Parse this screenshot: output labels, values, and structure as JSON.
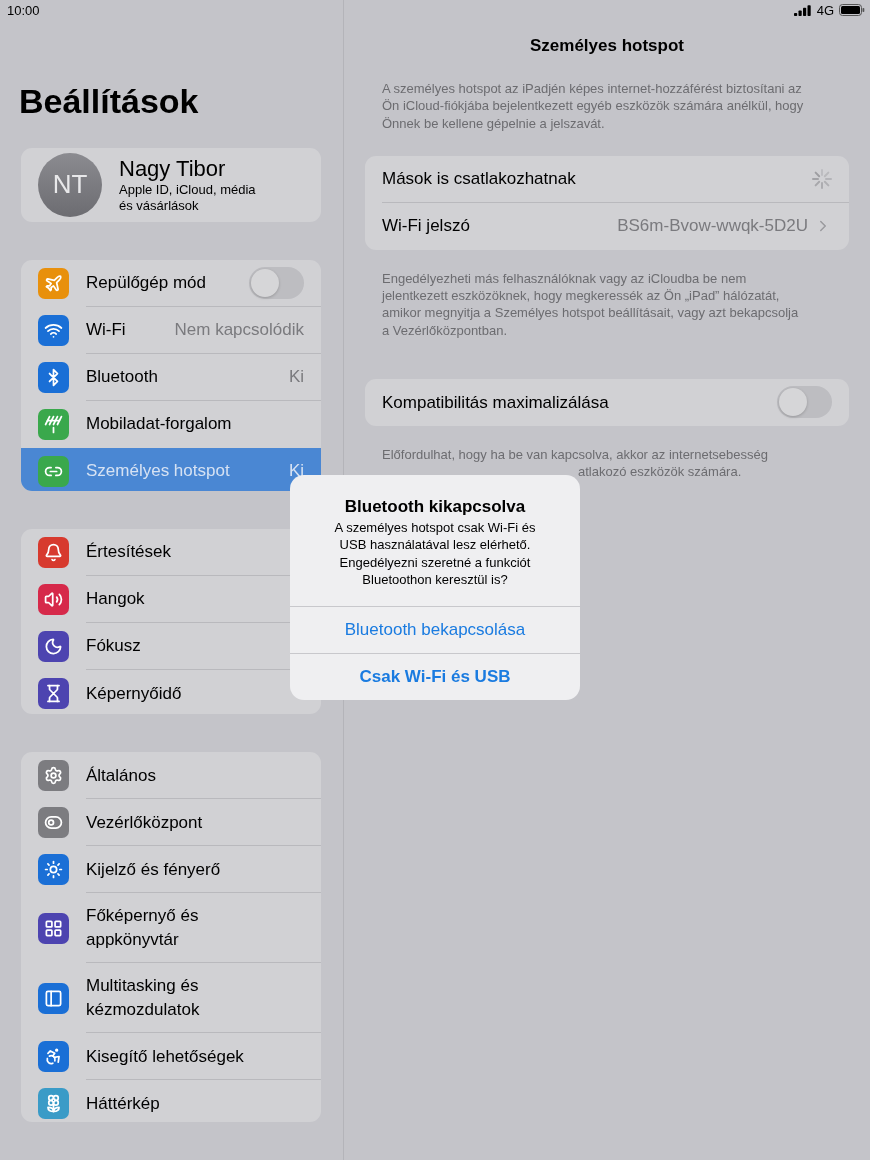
{
  "status_bar": {
    "time": "10:00",
    "network": "4G"
  },
  "sidebar": {
    "title": "Beállítások",
    "profile": {
      "initials": "NT",
      "name": "Nagy Tibor",
      "subtitle": "Apple ID, iCloud, média\nés vásárlások"
    },
    "groups": [
      {
        "items": [
          {
            "label": "Repülőgép mód",
            "kind": "toggle",
            "on": false,
            "color": "#e8900c",
            "selected": false
          },
          {
            "label": "Wi-Fi",
            "kind": "value",
            "value": "Nem kapcsolódik",
            "color": "#1a6fd6",
            "selected": false
          },
          {
            "label": "Bluetooth",
            "kind": "value",
            "value": "Ki",
            "color": "#1a6fd6",
            "selected": false
          },
          {
            "label": "Mobiladat-forgalom",
            "kind": "link",
            "color": "#3aa84c",
            "selected": false
          },
          {
            "label": "Személyes hotspot",
            "kind": "value",
            "value": "Ki",
            "color": "#3aa84c",
            "selected": true
          }
        ]
      },
      {
        "items": [
          {
            "label": "Értesítések",
            "kind": "link",
            "color": "#d73a2e",
            "selected": false
          },
          {
            "label": "Hangok",
            "kind": "link",
            "color": "#d6294a",
            "selected": false
          },
          {
            "label": "Fókusz",
            "kind": "link",
            "color": "#4d44b0",
            "selected": false
          },
          {
            "label": "Képernyőidő",
            "kind": "link",
            "color": "#4d44b0",
            "selected": false
          }
        ]
      },
      {
        "items": [
          {
            "label": "Általános",
            "kind": "link",
            "color": "#7c7c80",
            "selected": false
          },
          {
            "label": "Vezérlőközpont",
            "kind": "link",
            "color": "#7c7c80",
            "selected": false
          },
          {
            "label": "Kijelző és fényerő",
            "kind": "link",
            "color": "#1a6fd6",
            "selected": false
          },
          {
            "label": "Főképernyő és\nappkönyvtár",
            "kind": "link",
            "color": "#4d44b0",
            "selected": false
          },
          {
            "label": "Multitasking és\nkézmozdulatok",
            "kind": "link",
            "color": "#1a6fd6",
            "selected": false
          },
          {
            "label": "Kisegítő lehetőségek",
            "kind": "link",
            "color": "#1a6fd6",
            "selected": false
          },
          {
            "label": "Háttérkép",
            "kind": "link",
            "color": "#3a9bc7",
            "selected": false
          }
        ]
      }
    ]
  },
  "detail": {
    "title": "Személyes hotspot",
    "intro": "A személyes hotspot az iPadjén képes internet-hozzáférést biztosítani az Ön iCloud-fiókjába bejelentkezett egyéb eszközök számára anélkül, hogy Önnek be kellene gépelnie a jelszavát.",
    "sections": [
      {
        "rows": [
          {
            "label": "Mások is csatlakozhatnak",
            "kind": "spinner"
          },
          {
            "label": "Wi-Fi jelszó",
            "kind": "value",
            "value": "BS6m-Bvow-wwqk-5D2U"
          }
        ],
        "footer": [
          "Engedélyezheti más felhasználóknak vagy az iCloudba be nem jelentkezett eszközöknek, hogy megkeressék az Ön „iPad” hálózatát, amikor megnyitja a Személyes hotspot beállításait, vagy azt bekapcsolja a Vezérlőközpontban."
        ]
      },
      {
        "rows": [
          {
            "label": "Kompatibilitás maximalizálása",
            "kind": "toggle",
            "on": false
          }
        ],
        "footer": [
          "Előfordulhat, hogy ha be van kapcsolva, akkor az internetsebesség",
          "atlakozó eszközök számára."
        ]
      }
    ]
  },
  "alert": {
    "title": "Bluetooth kikapcsolva",
    "message": "A személyes hotspot csak Wi-Fi és USB használatával lesz elérhető. Engedélyezni szeretné a funkciót Bluetoothon keresztül is?",
    "buttons": [
      {
        "label": "Bluetooth bekapcsolása",
        "bold": false
      },
      {
        "label": "Csak Wi-Fi és USB",
        "bold": true
      }
    ]
  }
}
